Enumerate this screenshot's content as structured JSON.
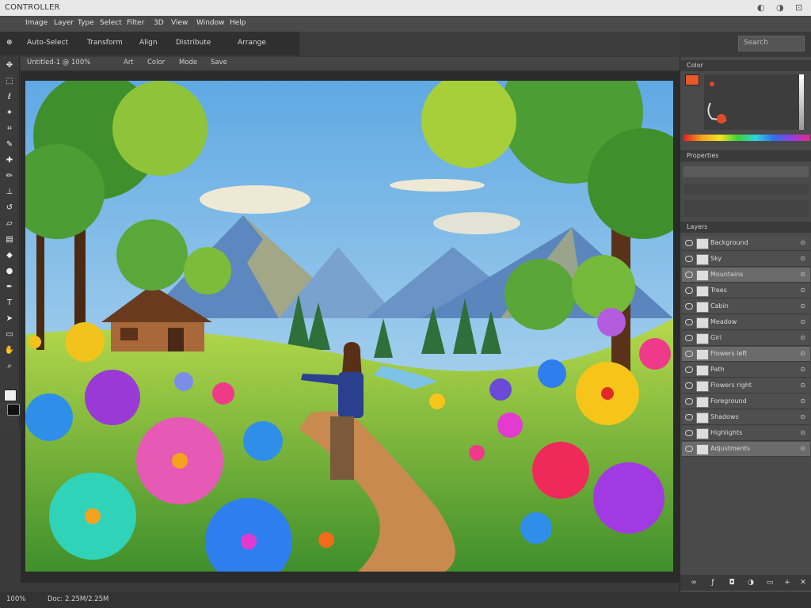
{
  "window": {
    "title": "CONTROLLER",
    "controls": [
      "◐",
      "◑",
      "⊡"
    ]
  },
  "menu": [
    "Image",
    "Layer",
    "Type",
    "Select",
    "Filter",
    "3D",
    "View",
    "Window",
    "Help"
  ],
  "options": [
    "Auto-Select",
    "Transform",
    "Align",
    "Distribute",
    "Arrange"
  ],
  "search": {
    "placeholder": "Search"
  },
  "tabs": [
    "Untitled-1 @ 100%",
    "Art",
    "Color",
    "Mode",
    "Save"
  ],
  "tools": [
    "move-icon",
    "marquee-icon",
    "lasso-icon",
    "wand-icon",
    "crop-icon",
    "eyedropper-icon",
    "heal-icon",
    "brush-icon",
    "stamp-icon",
    "history-icon",
    "eraser-icon",
    "gradient-icon",
    "blur-icon",
    "dodge-icon",
    "pen-icon",
    "type-icon",
    "path-icon",
    "shape-icon",
    "hand-icon",
    "zoom-icon",
    "swatch-fg-icon",
    "swatch-bg-icon"
  ],
  "panels": {
    "color": {
      "title": "Color"
    },
    "properties": {
      "title": "Properties"
    },
    "layers": {
      "title": "Layers",
      "items": [
        {
          "name": "Background",
          "selected": false
        },
        {
          "name": "Sky",
          "selected": false
        },
        {
          "name": "Mountains",
          "selected": true
        },
        {
          "name": "Trees",
          "selected": false
        },
        {
          "name": "Cabin",
          "selected": false
        },
        {
          "name": "Meadow",
          "selected": false
        },
        {
          "name": "Girl",
          "selected": false
        },
        {
          "name": "Flowers left",
          "selected": true
        },
        {
          "name": "Path",
          "selected": false
        },
        {
          "name": "Flowers right",
          "selected": false
        },
        {
          "name": "Foreground",
          "selected": false
        },
        {
          "name": "Shadows",
          "selected": false
        },
        {
          "name": "Highlights",
          "selected": false
        },
        {
          "name": "Adjustments",
          "selected": true
        }
      ]
    }
  },
  "status": {
    "zoom": "100%",
    "doc": "Doc: 2.25M/2.25M"
  },
  "colors": {
    "accent": "#6b6b6b",
    "sky": "#8cc4ea"
  }
}
